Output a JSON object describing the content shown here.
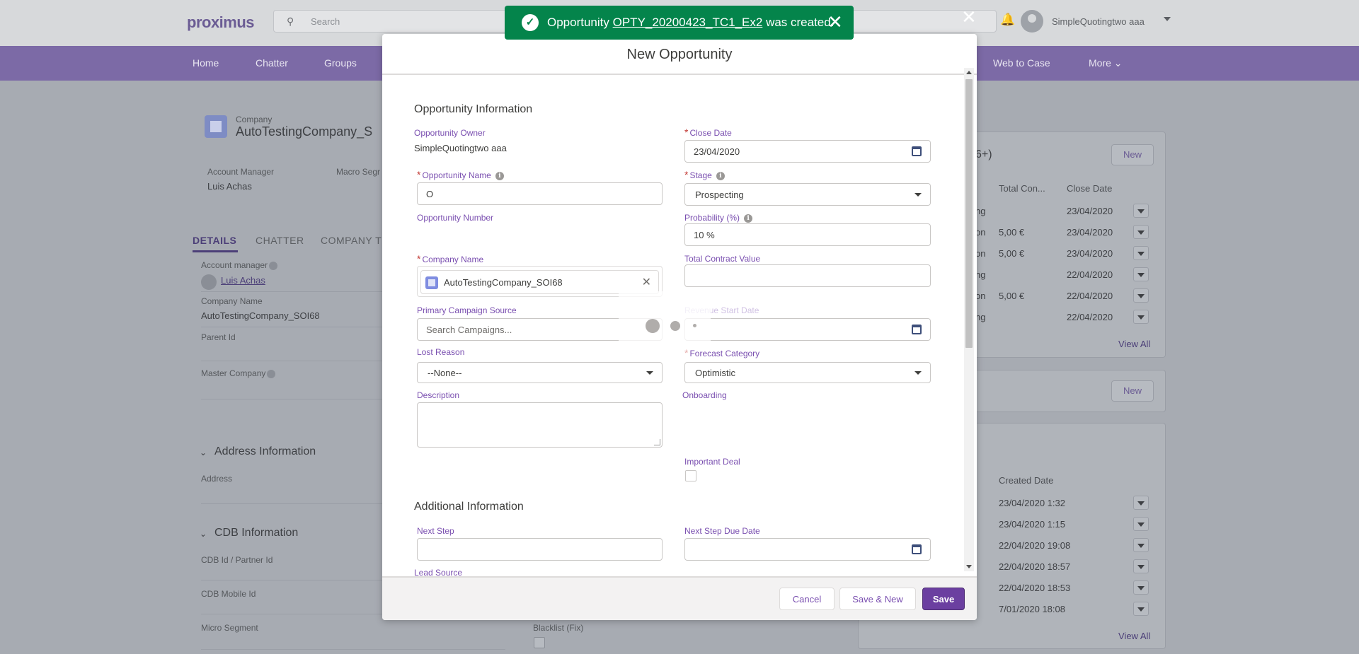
{
  "colors": {
    "brand": "#6b3fa0",
    "nav": "#7c6aa6",
    "toast_success": "#04844b",
    "required": "#c23934"
  },
  "app": {
    "logo": "proximus",
    "search_placeholder": "Search",
    "user_name": "SimpleQuotingtwo aaa"
  },
  "nav": {
    "items": [
      "Home",
      "Chatter",
      "Groups",
      "Web to Case",
      "More"
    ]
  },
  "record": {
    "object_label": "Company",
    "title": "AutoTestingCompany_S",
    "account_manager_label": "Account Manager",
    "account_manager_value": "Luis Achas",
    "macro_segment_label": "Macro Segr",
    "tabs": [
      "DETAILS",
      "CHATTER",
      "COMPANY T"
    ],
    "fields": {
      "account_manager_label": "Account manager",
      "account_manager_value": "Luis Achas",
      "company_name_label": "Company Name",
      "company_name_value": "AutoTestingCompany_SOI68",
      "parent_id_label": "Parent Id",
      "master_company_label": "Master Company"
    },
    "sections": {
      "address": "Address Information",
      "address_label": "Address",
      "cdb": "CDB Information",
      "cdb_partner_label": "CDB Id / Partner Id",
      "cdb_mobile_label": "CDB Mobile Id",
      "micro_segment_label": "Micro Segment",
      "blacklist_label": "Blacklist (Fix)"
    }
  },
  "related": {
    "opps_title": "6+)",
    "new_label": "New",
    "headers": [
      "Total Con...",
      "Close Date"
    ],
    "rows": [
      {
        "a": "ng",
        "b": "",
        "c": "23/04/2020"
      },
      {
        "a": "on",
        "b": "5,00 €",
        "c": "23/04/2020"
      },
      {
        "a": "on",
        "b": "5,00 €",
        "c": "23/04/2020"
      },
      {
        "a": "ng",
        "b": "",
        "c": "22/04/2020"
      },
      {
        "a": "on",
        "b": "5,00 €",
        "c": "22/04/2020"
      },
      {
        "a": "ng",
        "b": "",
        "c": "22/04/2020"
      }
    ],
    "view_all": "View All",
    "second_header": "Created Date",
    "second_rows": [
      "23/04/2020 1:32",
      "23/04/2020 1:15",
      "22/04/2020 19:08",
      "22/04/2020 18:57",
      "22/04/2020 18:53",
      "7/01/2020 18:08"
    ]
  },
  "toast": {
    "prefix": "Opportunity",
    "link": "OPTY_20200423_TC1_Ex2",
    "suffix": "was created."
  },
  "modal": {
    "title": "New Opportunity",
    "section_opportunity": "Opportunity Information",
    "section_additional": "Additional Information",
    "fields": {
      "owner_label": "Opportunity Owner",
      "owner_value": "SimpleQuotingtwo aaa",
      "close_date_label": "Close Date",
      "close_date_value": "23/04/2020",
      "opp_name_label": "Opportunity Name",
      "opp_name_value": "O",
      "stage_label": "Stage",
      "stage_value": "Prospecting",
      "opp_number_label": "Opportunity Number",
      "probability_label": "Probability (%)",
      "probability_value": "10 %",
      "company_label": "Company Name",
      "company_value": "AutoTestingCompany_SOI68",
      "tcv_label": "Total Contract Value",
      "campaign_label": "Primary Campaign Source",
      "campaign_placeholder": "Search Campaigns...",
      "revenue_start_label": "Revenue Start Date",
      "lost_reason_label": "Lost Reason",
      "lost_reason_value": "--None--",
      "forecast_label": "Forecast Category",
      "forecast_value": "Optimistic",
      "description_label": "Description",
      "onboarding_label": "Onboarding",
      "important_deal_label": "Important Deal",
      "next_step_label": "Next Step",
      "next_step_due_label": "Next Step Due Date",
      "lead_source_label": "Lead Source"
    },
    "buttons": {
      "cancel": "Cancel",
      "save_new": "Save & New",
      "save": "Save"
    }
  }
}
